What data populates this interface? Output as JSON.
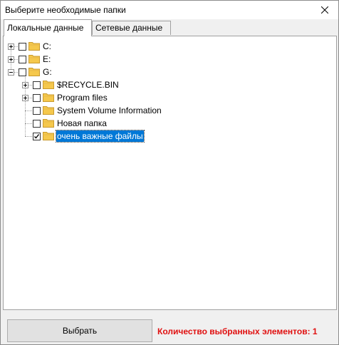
{
  "window": {
    "title": "Выберите необходимые папки"
  },
  "tabs": [
    {
      "label": "Локальные данные",
      "active": true
    },
    {
      "label": "Сетевые данные",
      "active": false
    }
  ],
  "tree": [
    {
      "label": "C:",
      "level": 0,
      "expander": "plus",
      "checked": false,
      "selected": false
    },
    {
      "label": "E:",
      "level": 0,
      "expander": "plus",
      "checked": false,
      "selected": false
    },
    {
      "label": "G:",
      "level": 0,
      "expander": "minus",
      "checked": false,
      "selected": false
    },
    {
      "label": "$RECYCLE.BIN",
      "level": 1,
      "expander": "plus",
      "checked": false,
      "selected": false
    },
    {
      "label": "Program files",
      "level": 1,
      "expander": "plus",
      "checked": false,
      "selected": false
    },
    {
      "label": "System Volume Information",
      "level": 1,
      "expander": "none",
      "checked": false,
      "selected": false
    },
    {
      "label": "Новая папка",
      "level": 1,
      "expander": "none",
      "checked": false,
      "selected": false
    },
    {
      "label": "очень важные файлы",
      "level": 1,
      "expander": "none",
      "checked": true,
      "selected": true
    }
  ],
  "footer": {
    "select_label": "Выбрать",
    "status_text": "Количество выбранных элементов: 1"
  },
  "colors": {
    "status": "#e01010",
    "selection": "#0078d7",
    "folder": "#f5c84c"
  },
  "icons": {
    "close": "close-icon",
    "folder": "folder-icon",
    "check": "checkmark-icon"
  }
}
